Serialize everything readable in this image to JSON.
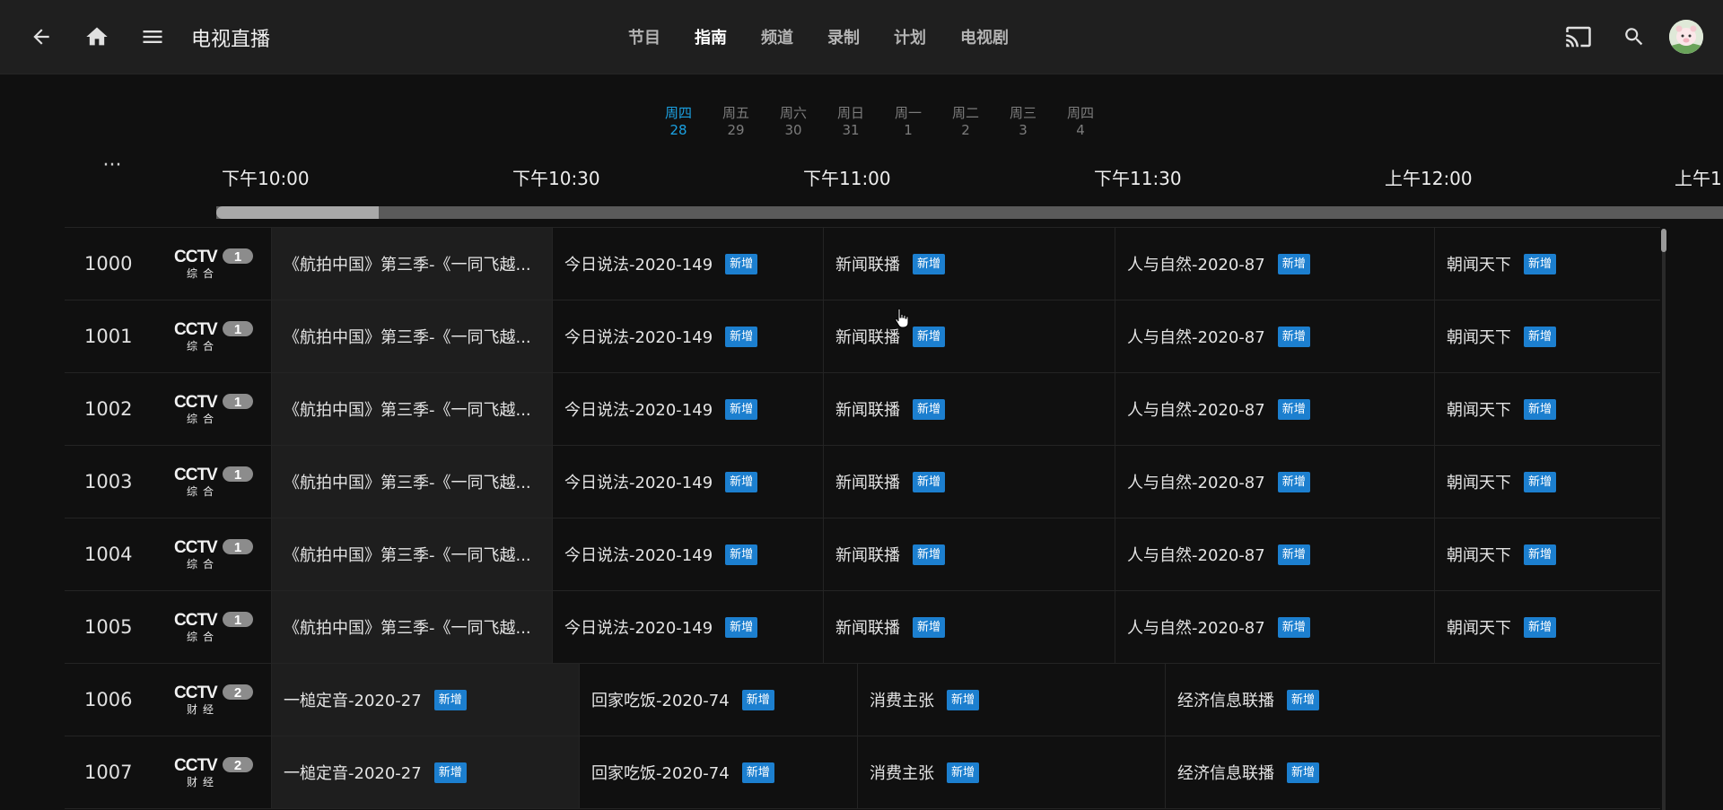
{
  "header": {
    "title": "电视直播",
    "tabs": [
      {
        "label": "节目",
        "active": false
      },
      {
        "label": "指南",
        "active": true
      },
      {
        "label": "频道",
        "active": false
      },
      {
        "label": "录制",
        "active": false
      },
      {
        "label": "计划",
        "active": false
      },
      {
        "label": "电视剧",
        "active": false
      }
    ],
    "icons": [
      "back-arrow-icon",
      "home-icon",
      "menu-icon",
      "cast-icon",
      "search-icon",
      "avatar"
    ]
  },
  "days": [
    {
      "weekday": "周四",
      "date": "28",
      "active": true
    },
    {
      "weekday": "周五",
      "date": "29",
      "active": false
    },
    {
      "weekday": "周六",
      "date": "30",
      "active": false
    },
    {
      "weekday": "周日",
      "date": "31",
      "active": false
    },
    {
      "weekday": "周一",
      "date": "1",
      "active": false
    },
    {
      "weekday": "周二",
      "date": "2",
      "active": false
    },
    {
      "weekday": "周三",
      "date": "3",
      "active": false
    },
    {
      "weekday": "周四",
      "date": "4",
      "active": false
    }
  ],
  "timeline": {
    "more_label": "···",
    "times": [
      "下午10:00",
      "下午10:30",
      "下午11:00",
      "下午11:30",
      "上午12:00",
      "上午1"
    ]
  },
  "badge_label": "新增",
  "colors": {
    "accent": "#1ba1e2",
    "badge": "#1c7fcf",
    "background": "#101010",
    "header": "#1f1f1f"
  },
  "channels": [
    {
      "number": "1000",
      "logo": "CCTV1 综合",
      "programs": [
        {
          "title": "《航拍中国》第三季-《一同飞越...",
          "badge": false
        },
        {
          "title": "今日说法-2020-149",
          "badge": true
        },
        {
          "title": "新闻联播",
          "badge": true
        },
        {
          "title": "人与自然-2020-87",
          "badge": true
        },
        {
          "title": "朝闻天下",
          "badge": true
        }
      ]
    },
    {
      "number": "1001",
      "logo": "CCTV1 综合",
      "programs": [
        {
          "title": "《航拍中国》第三季-《一同飞越...",
          "badge": false
        },
        {
          "title": "今日说法-2020-149",
          "badge": true
        },
        {
          "title": "新闻联播",
          "badge": true
        },
        {
          "title": "人与自然-2020-87",
          "badge": true
        },
        {
          "title": "朝闻天下",
          "badge": true
        }
      ]
    },
    {
      "number": "1002",
      "logo": "CCTV1 综合",
      "programs": [
        {
          "title": "《航拍中国》第三季-《一同飞越...",
          "badge": false
        },
        {
          "title": "今日说法-2020-149",
          "badge": true
        },
        {
          "title": "新闻联播",
          "badge": true
        },
        {
          "title": "人与自然-2020-87",
          "badge": true
        },
        {
          "title": "朝闻天下",
          "badge": true
        }
      ]
    },
    {
      "number": "1003",
      "logo": "CCTV1 综合",
      "programs": [
        {
          "title": "《航拍中国》第三季-《一同飞越...",
          "badge": false
        },
        {
          "title": "今日说法-2020-149",
          "badge": true
        },
        {
          "title": "新闻联播",
          "badge": true
        },
        {
          "title": "人与自然-2020-87",
          "badge": true
        },
        {
          "title": "朝闻天下",
          "badge": true
        }
      ]
    },
    {
      "number": "1004",
      "logo": "CCTV1 综合",
      "programs": [
        {
          "title": "《航拍中国》第三季-《一同飞越...",
          "badge": false
        },
        {
          "title": "今日说法-2020-149",
          "badge": true
        },
        {
          "title": "新闻联播",
          "badge": true
        },
        {
          "title": "人与自然-2020-87",
          "badge": true
        },
        {
          "title": "朝闻天下",
          "badge": true
        }
      ]
    },
    {
      "number": "1005",
      "logo": "CCTV1 综合",
      "programs": [
        {
          "title": "《航拍中国》第三季-《一同飞越...",
          "badge": false
        },
        {
          "title": "今日说法-2020-149",
          "badge": true
        },
        {
          "title": "新闻联播",
          "badge": true
        },
        {
          "title": "人与自然-2020-87",
          "badge": true
        },
        {
          "title": "朝闻天下",
          "badge": true
        }
      ]
    },
    {
      "number": "1006",
      "logo": "CCTV2 财经",
      "programs": [
        {
          "title": "一槌定音-2020-27",
          "badge": true
        },
        {
          "title": "回家吃饭-2020-74",
          "badge": true
        },
        {
          "title": "消费主张",
          "badge": true
        },
        {
          "title": "经济信息联播",
          "badge": true
        }
      ]
    },
    {
      "number": "1007",
      "logo": "CCTV2 财经",
      "programs": [
        {
          "title": "一槌定音-2020-27",
          "badge": true
        },
        {
          "title": "回家吃饭-2020-74",
          "badge": true
        },
        {
          "title": "消费主张",
          "badge": true
        },
        {
          "title": "经济信息联播",
          "badge": true
        }
      ]
    }
  ]
}
